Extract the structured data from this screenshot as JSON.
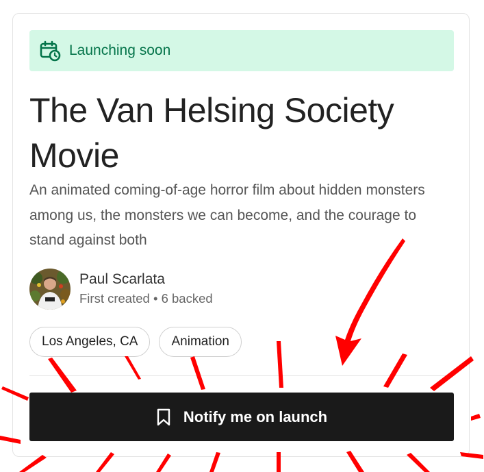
{
  "banner": {
    "icon": "calendar-clock-icon",
    "label": "Launching soon",
    "bg_color": "#d4f8e6",
    "text_color": "#04744a"
  },
  "project": {
    "title": "The Van Helsing Society Movie",
    "description": "An animated coming-of-age horror film about hidden monsters among us, the monsters we can become, and the courage to stand against both"
  },
  "creator": {
    "name": "Paul Scarlata",
    "meta": "First created • 6 backed",
    "avatar_icon": "creator-avatar"
  },
  "tags": [
    {
      "label": "Los Angeles, CA"
    },
    {
      "label": "Animation"
    }
  ],
  "cta": {
    "icon": "bookmark-icon",
    "label": "Notify me on launch",
    "bg_color": "#1a1a1a"
  },
  "annotation": {
    "color": "#ff0000",
    "type": "red arrow pointing at button with emphasis lines"
  }
}
